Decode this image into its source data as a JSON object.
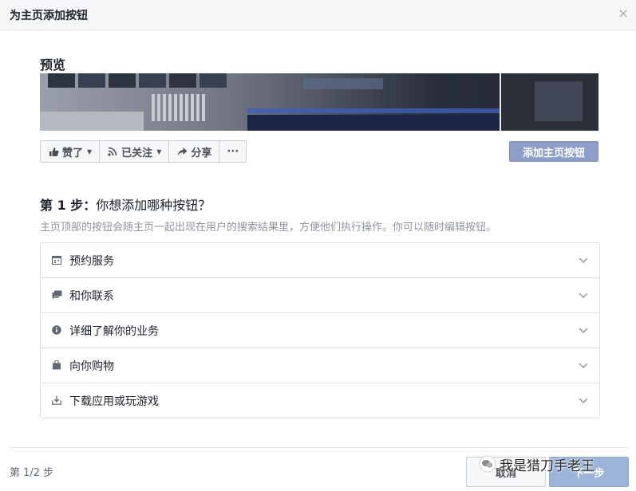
{
  "dialog": {
    "title": "为主页添加按钮",
    "close_icon": "×"
  },
  "preview": {
    "label": "预览",
    "actions": {
      "like": "赞了",
      "follow": "已关注",
      "share": "分享",
      "more": "···"
    },
    "add_button": "添加主页按钮"
  },
  "step": {
    "prefix": "第 1 步：",
    "question": "你想添加哪种按钮？",
    "description": "主页顶部的按钮会随主页一起出现在用户的搜索结果里，方便他们执行操作。你可以随时编辑按钮。"
  },
  "options": [
    {
      "label": "预约服务",
      "icon": "calendar-icon"
    },
    {
      "label": "和你联系",
      "icon": "chat-icon"
    },
    {
      "label": "详细了解你的业务",
      "icon": "info-icon"
    },
    {
      "label": "向你购物",
      "icon": "shopping-bag-icon"
    },
    {
      "label": "下载应用或玩游戏",
      "icon": "download-icon"
    }
  ],
  "footer": {
    "step_count": "第 1/2 步",
    "cancel": "取消",
    "next": "下一步"
  },
  "watermark": {
    "text": "我是猎刀手老王"
  },
  "colors": {
    "primary_disabled": "#8d9fc8",
    "border": "#dddfe2",
    "muted_text": "#90949c"
  }
}
